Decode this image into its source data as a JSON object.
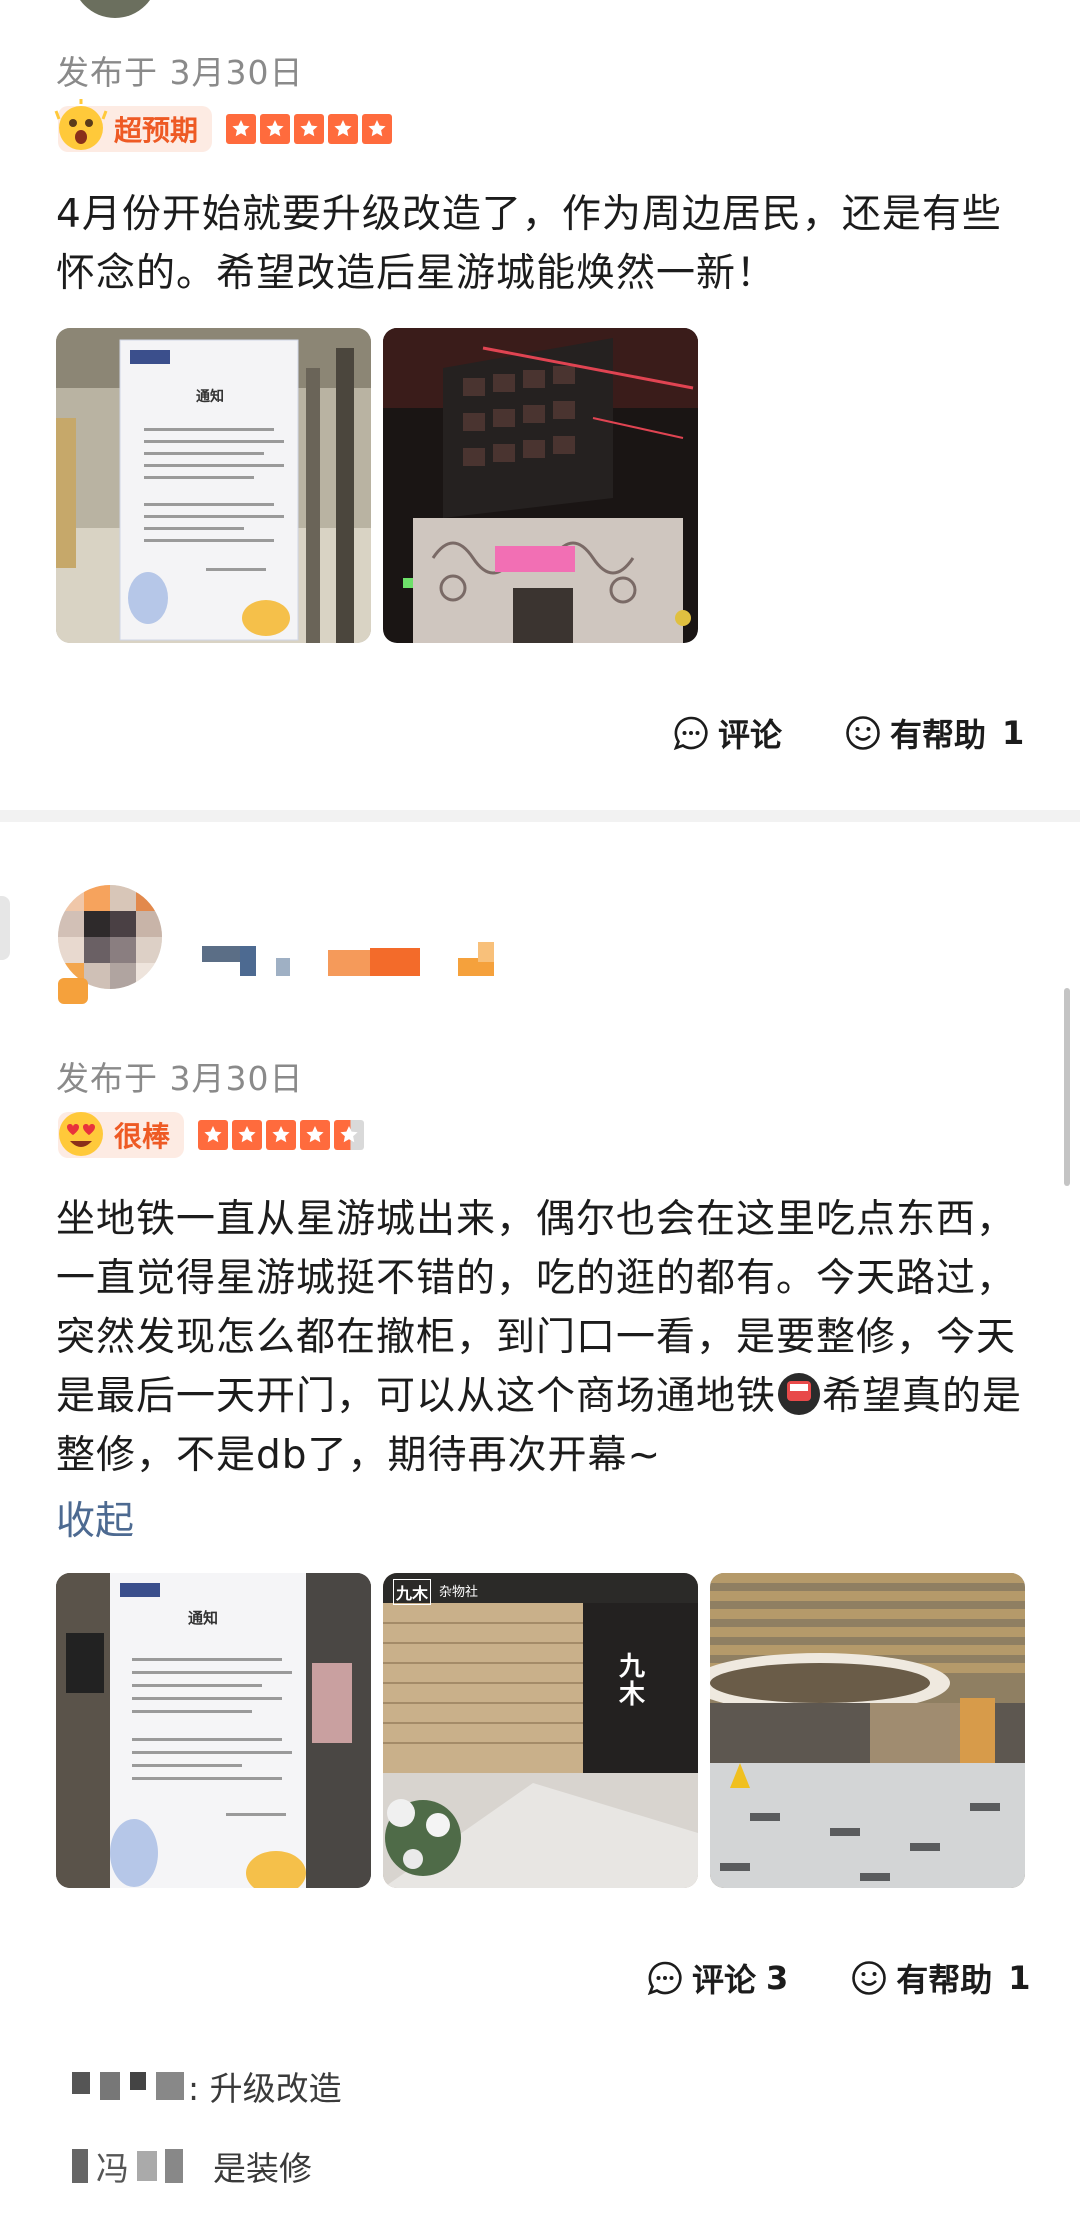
{
  "review1": {
    "date": "发布于 3月30日",
    "mood_label": "超预期",
    "stars": 5,
    "text": "4月份开始就要升级改造了，作为周边居民，还是有些怀念的。希望改造后星游城能焕然一新！",
    "photo1": {
      "notice_title": "通知"
    },
    "comment_label": "评论",
    "helpful_label": "有帮助",
    "helpful_count": "1"
  },
  "review2": {
    "date": "发布于 3月30日",
    "mood_label": "很棒",
    "stars": 4.5,
    "text_part1": "坐地铁一直从星游城出来，偶尔也会在这里吃点东西，一直觉得星游城挺不错的，吃的逛的都有。今天路过，突然发现怎么都在撤柜，到门口一看，是要整修，今天是最后一天开门，可以从这个商场通地铁",
    "text_part2": "希望真的是整修，不是db了，期待再次开幕~",
    "collapse_label": "收起",
    "photo1": {
      "notice_title": "通知"
    },
    "photo2": {
      "store_mark": "九木",
      "store_name": "杂物社"
    },
    "comment_label": "评论",
    "comment_count": "3",
    "helpful_label": "有帮助",
    "helpful_count": "1"
  },
  "replies": [
    {
      "text": ": 升级改造"
    },
    {
      "text": "是装修",
      "partial_name": "冯"
    }
  ],
  "colors": {
    "accent": "#ee5a24",
    "star": "#ff6b3d",
    "link": "#4d6a91"
  }
}
